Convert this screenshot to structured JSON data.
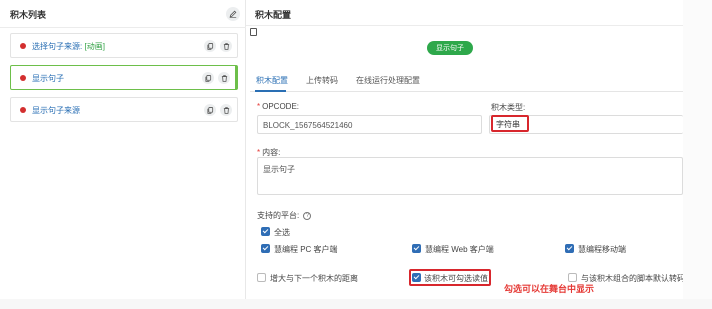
{
  "left_panel": {
    "title": "积木列表",
    "items": [
      {
        "prefix": "选择句子来源:",
        "tag": "[动画]"
      },
      {
        "prefix": "显示句子",
        "tag": ""
      },
      {
        "prefix": "显示句子来源",
        "tag": ""
      }
    ],
    "selected_index": 1
  },
  "right_panel": {
    "title": "积木配置",
    "preview_block_label": "显示句子",
    "tabs": [
      "积木配置",
      "上传转码",
      "在线运行处理配置"
    ],
    "active_tab": "积木配置",
    "opcode_label": "OPCODE:",
    "opcode_value": "BLOCK_1567564521460",
    "type_label": "积木类型:",
    "type_value": "字符串",
    "content_label": "内容:",
    "content_value": "显示句子",
    "platforms_label": "支持的平台",
    "help_glyph": "?",
    "select_all_label": "全选",
    "platforms": [
      "慧编程 PC 客户端",
      "慧编程 Web 客户端",
      "慧编程移动端"
    ],
    "options": [
      {
        "label": "增大与下一个积木的距离",
        "checked": false
      },
      {
        "label": "该积木可勾选读值",
        "checked": true
      },
      {
        "label": "与该积木组合的脚本默认转码",
        "checked": false
      }
    ]
  },
  "annotation": "勾选可以在舞台中显示",
  "colors": {
    "accent_blue": "#2a6fb4",
    "accent_green": "#2ea84b",
    "selected_border": "#6dbf4a",
    "highlight_red": "#d8272d",
    "dot_red": "#d32f2f"
  }
}
